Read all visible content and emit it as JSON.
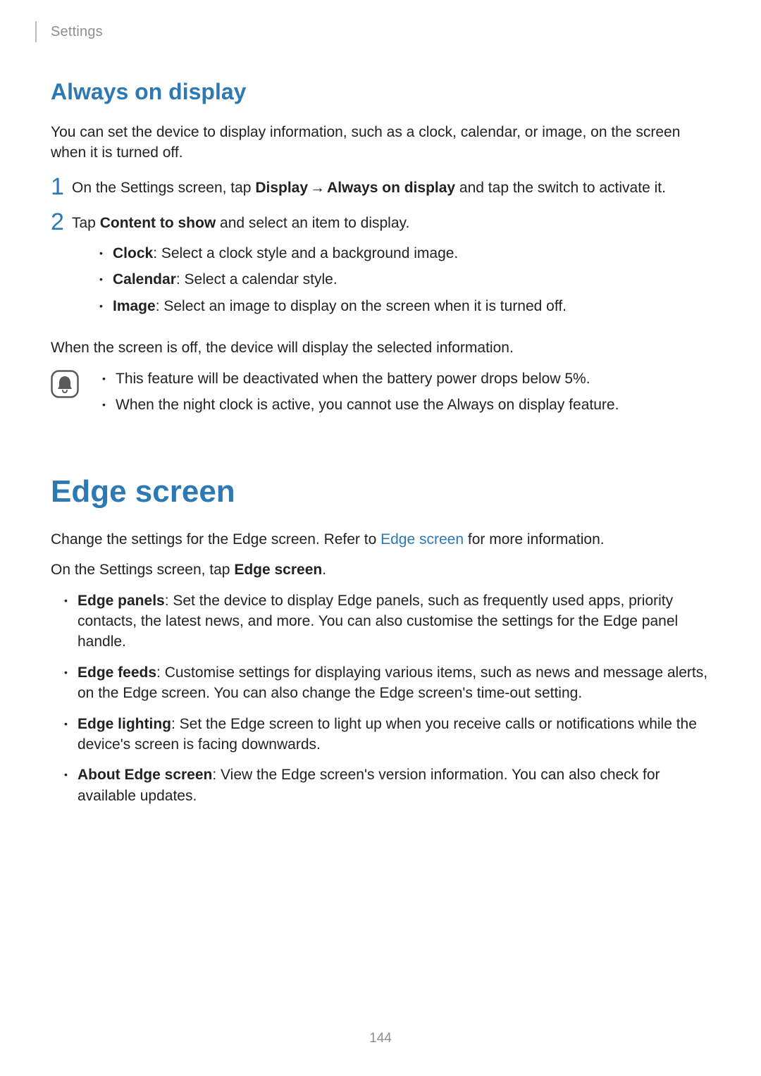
{
  "header": {
    "section": "Settings"
  },
  "aod": {
    "title": "Always on display",
    "intro": "You can set the device to display information, such as a clock, calendar, or image, on the screen when it is turned off.",
    "step1_num": "1",
    "step1_a": "On the Settings screen, tap ",
    "step1_b": "Display",
    "step1_arrow": "→",
    "step1_c": "Always on display",
    "step1_d": " and tap the switch to activate it.",
    "step2_num": "2",
    "step2_a": "Tap ",
    "step2_b": "Content to show",
    "step2_c": " and select an item to display.",
    "opts": {
      "clock_label": "Clock",
      "clock_desc": ": Select a clock style and a background image.",
      "cal_label": "Calendar",
      "cal_desc": ": Select a calendar style.",
      "img_label": "Image",
      "img_desc": ": Select an image to display on the screen when it is turned off."
    },
    "after": "When the screen is off, the device will display the selected information.",
    "notes": {
      "n1": "This feature will be deactivated when the battery power drops below 5%.",
      "n2": "When the night clock is active, you cannot use the Always on display feature."
    }
  },
  "edge": {
    "title": "Edge screen",
    "intro_a": "Change the settings for the Edge screen. Refer to ",
    "intro_link": "Edge screen",
    "intro_b": " for more information.",
    "tap_a": "On the Settings screen, tap ",
    "tap_b": "Edge screen",
    "tap_c": ".",
    "items": {
      "panels_label": "Edge panels",
      "panels_desc": ": Set the device to display Edge panels, such as frequently used apps, priority contacts, the latest news, and more. You can also customise the settings for the Edge panel handle.",
      "feeds_label": "Edge feeds",
      "feeds_desc": ": Customise settings for displaying various items, such as news and message alerts, on the Edge screen. You can also change the Edge screen's time-out setting.",
      "lighting_label": "Edge lighting",
      "lighting_desc": ": Set the Edge screen to light up when you receive calls or notifications while the device's screen is facing downwards.",
      "about_label": "About Edge screen",
      "about_desc": ": View the Edge screen's version information. You can also check for available updates."
    }
  },
  "page_number": "144"
}
